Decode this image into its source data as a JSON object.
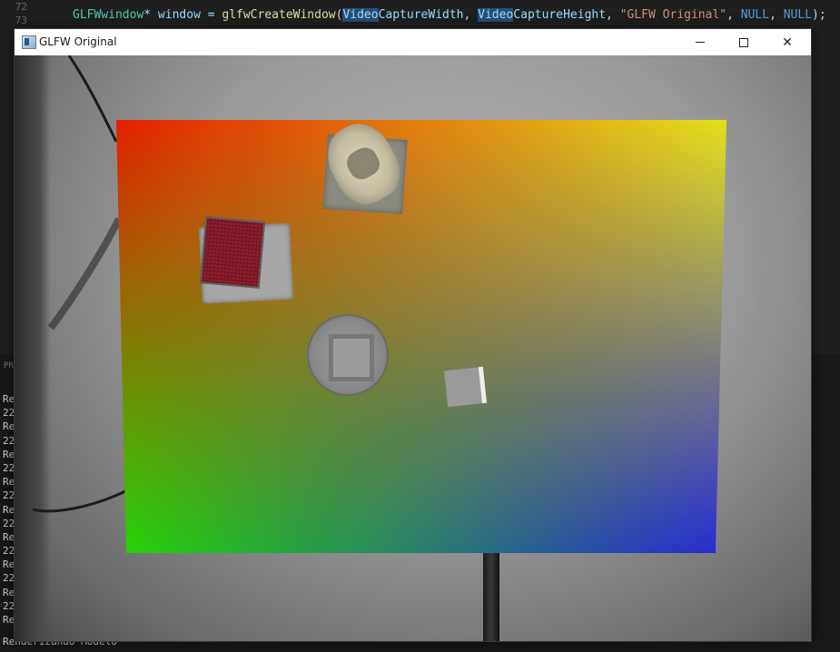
{
  "editor": {
    "line_numbers": [
      "72",
      "73"
    ],
    "code_line": {
      "type": "GLFWwindow",
      "star_var": "* window = ",
      "fn": "glfwCreateWindow",
      "open": "(",
      "arg1_hl": "Video",
      "arg1_rest": "CaptureWidth",
      "sep1": ", ",
      "arg2_hl": "Video",
      "arg2_rest": "CaptureHeight",
      "sep2": ", ",
      "str": "\"GLFW Original\"",
      "sep3": ", ",
      "null1": "NULL",
      "sep4": ", ",
      "null2": "NULL",
      "close": ");"
    }
  },
  "terminal": {
    "panel_label": "PR",
    "lines": [
      "Re",
      "22",
      "Re",
      "22",
      "Re",
      "22",
      "Re",
      "22",
      "Re",
      "22",
      "Re",
      "22",
      "Re",
      "22",
      "Re",
      "22",
      "Re"
    ],
    "last_line": "Renderizando Modelo"
  },
  "glfw_window": {
    "title": "GLFW Original",
    "controls": {
      "minimize": "minimize-icon",
      "maximize": "maximize-icon",
      "close": "close-icon"
    },
    "close_glyph": "✕"
  },
  "colors": {
    "quad_top_left": "#ff0000",
    "quad_top_right": "#ffff00",
    "quad_bottom_left": "#00ff00",
    "quad_bottom_right": "#0000ff"
  }
}
